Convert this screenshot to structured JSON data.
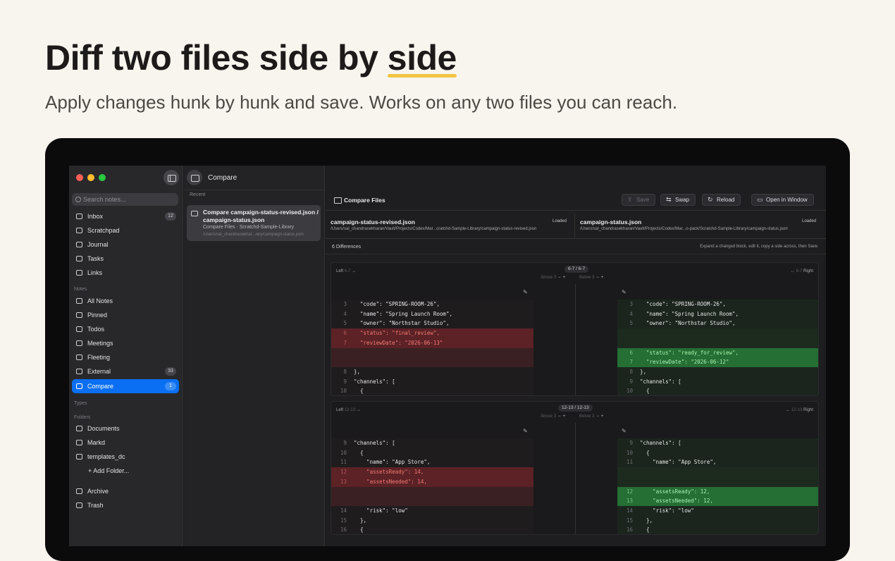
{
  "hero": {
    "title_prefix": "Diff two files side by ",
    "title_highlight": "side",
    "subtitle": "Apply changes hunk by hunk and save. Works on any two files you can reach."
  },
  "colors": {
    "accent": "#0a6ff2",
    "highlight": "#f3c543",
    "deletion": "#5c2226",
    "addition": "#256e34"
  },
  "sidebar": {
    "search_placeholder": "Search notes...",
    "top_items": [
      {
        "label": "Inbox",
        "badge": "12",
        "icon": "inbox-icon"
      },
      {
        "label": "Scratchpad",
        "icon": "scratchpad-icon"
      },
      {
        "label": "Journal",
        "icon": "journal-icon"
      },
      {
        "label": "Tasks",
        "icon": "tasks-icon"
      },
      {
        "label": "Links",
        "icon": "links-icon"
      }
    ],
    "notes_header": "Notes",
    "note_items": [
      {
        "label": "All Notes",
        "icon": "notes-icon"
      },
      {
        "label": "Pinned",
        "icon": "pin-icon"
      },
      {
        "label": "Todos",
        "icon": "todos-icon"
      },
      {
        "label": "Meetings",
        "icon": "meetings-icon"
      },
      {
        "label": "Fleeting",
        "icon": "fleeting-icon"
      },
      {
        "label": "External",
        "badge": "33",
        "icon": "external-icon"
      },
      {
        "label": "Compare",
        "badge": "1",
        "icon": "compare-icon"
      }
    ],
    "types_header": "Types",
    "folders_header": "Folders",
    "folders": [
      {
        "label": "Documents",
        "icon": "folder-icon"
      },
      {
        "label": "Markd",
        "icon": "folder-icon"
      },
      {
        "label": "templates_dc",
        "icon": "folder-icon"
      }
    ],
    "add_folder": "+ Add Folder...",
    "bottom_items": [
      {
        "label": "Archive",
        "icon": "archive-icon"
      },
      {
        "label": "Trash",
        "icon": "trash-icon"
      }
    ]
  },
  "middle": {
    "title": "Compare",
    "recent_label": "Recent",
    "card": {
      "title": "Compare campaign-status-revised.json / campaign-status.json",
      "subtitle": "Compare Files · Scratchd-Sample-Library",
      "path": "/Users/sal_chandrasekhar.../ary/campaign-status.json"
    }
  },
  "toolbar": {
    "title": "Compare Files",
    "save": "Save",
    "swap": "Swap",
    "reload": "Reload",
    "open_window": "Open in Window"
  },
  "files": {
    "left": {
      "name": "campaign-status-revised.json",
      "status": "Loaded",
      "path": "/Users/sal_chandrasekharan/Vault/Projects/Codex/Mar...cratchd-Sample-Library/campaign-status-revised.json"
    },
    "right": {
      "name": "campaign-status.json",
      "status": "Loaded",
      "path": "/Users/sal_chandrasekharan/Vault/Projects/Codex/Mar...o-pack/Scratchd-Sample-Library/campaign-status.json"
    }
  },
  "status": {
    "count": "6 Differences",
    "hint": "Expand a changed block, edit it, copy a side across, then Save"
  },
  "hunks": [
    {
      "range": "6-7 / 6-7",
      "left_label": "Left",
      "left_range": "6-7",
      "right_label": "Right",
      "right_range": "6-7",
      "above": "Above 3",
      "below": "Below 3",
      "left_lines": [
        {
          "no": "3",
          "text": "  \"code\": \"SPRING-ROOM-26\",",
          "kind": "ctx"
        },
        {
          "no": "4",
          "text": "  \"name\": \"Spring Launch Room\",",
          "kind": "ctx"
        },
        {
          "no": "5",
          "text": "  \"owner\": \"Northstar Studio\",",
          "kind": "ctx"
        },
        {
          "no": "6",
          "text": "  \"status\": \"final_review\",",
          "kind": "del"
        },
        {
          "no": "7",
          "text": "  \"reviewDate\": \"2026-06-13\"",
          "kind": "del"
        },
        {
          "no": "",
          "text": "",
          "kind": "ghost"
        },
        {
          "no": "",
          "text": "",
          "kind": "ghost"
        },
        {
          "no": "8",
          "text": "},",
          "kind": "ctx"
        },
        {
          "no": "9",
          "text": "\"channels\": [",
          "kind": "ctx"
        },
        {
          "no": "10",
          "text": "  {",
          "kind": "ctx"
        }
      ],
      "right_lines": [
        {
          "no": "3",
          "text": "  \"code\": \"SPRING-ROOM-26\",",
          "kind": "ctx"
        },
        {
          "no": "4",
          "text": "  \"name\": \"Spring Launch Room\",",
          "kind": "ctx"
        },
        {
          "no": "5",
          "text": "  \"owner\": \"Northstar Studio\",",
          "kind": "ctx"
        },
        {
          "no": "",
          "text": "",
          "kind": "ghostg"
        },
        {
          "no": "",
          "text": "",
          "kind": "ghostg"
        },
        {
          "no": "6",
          "text": "  \"status\": \"ready_for_review\",",
          "kind": "add"
        },
        {
          "no": "7",
          "text": "  \"reviewDate\": \"2026-06-12\"",
          "kind": "add"
        },
        {
          "no": "8",
          "text": "},",
          "kind": "ctx"
        },
        {
          "no": "9",
          "text": "\"channels\": [",
          "kind": "ctx"
        },
        {
          "no": "10",
          "text": "  {",
          "kind": "ctx"
        }
      ]
    },
    {
      "range": "12-13 / 12-13",
      "left_label": "Left",
      "left_range": "12-13",
      "right_label": "Right",
      "right_range": "12-13",
      "above": "Above 3",
      "below": "Below 3",
      "left_lines": [
        {
          "no": "9",
          "text": "\"channels\": [",
          "kind": "ctx"
        },
        {
          "no": "10",
          "text": "  {",
          "kind": "ctx"
        },
        {
          "no": "11",
          "text": "    \"name\": \"App Store\",",
          "kind": "ctx"
        },
        {
          "no": "12",
          "text": "    \"assetsReady\": 14,",
          "kind": "del"
        },
        {
          "no": "13",
          "text": "    \"assetsNeeded\": 14,",
          "kind": "del"
        },
        {
          "no": "",
          "text": "",
          "kind": "ghost"
        },
        {
          "no": "",
          "text": "",
          "kind": "ghost"
        },
        {
          "no": "14",
          "text": "    \"risk\": \"low\"",
          "kind": "ctx"
        },
        {
          "no": "15",
          "text": "  },",
          "kind": "ctx"
        },
        {
          "no": "16",
          "text": "  {",
          "kind": "ctx"
        }
      ],
      "right_lines": [
        {
          "no": "9",
          "text": "\"channels\": [",
          "kind": "ctx"
        },
        {
          "no": "10",
          "text": "  {",
          "kind": "ctx"
        },
        {
          "no": "11",
          "text": "    \"name\": \"App Store\",",
          "kind": "ctx"
        },
        {
          "no": "",
          "text": "",
          "kind": "ghostg"
        },
        {
          "no": "",
          "text": "",
          "kind": "ghostg"
        },
        {
          "no": "12",
          "text": "    \"assetsReady\": 12,",
          "kind": "add"
        },
        {
          "no": "13",
          "text": "    \"assetsNeeded\": 12,",
          "kind": "add"
        },
        {
          "no": "14",
          "text": "    \"risk\": \"low\"",
          "kind": "ctx"
        },
        {
          "no": "15",
          "text": "  },",
          "kind": "ctx"
        },
        {
          "no": "16",
          "text": "  {",
          "kind": "ctx"
        }
      ]
    }
  ]
}
